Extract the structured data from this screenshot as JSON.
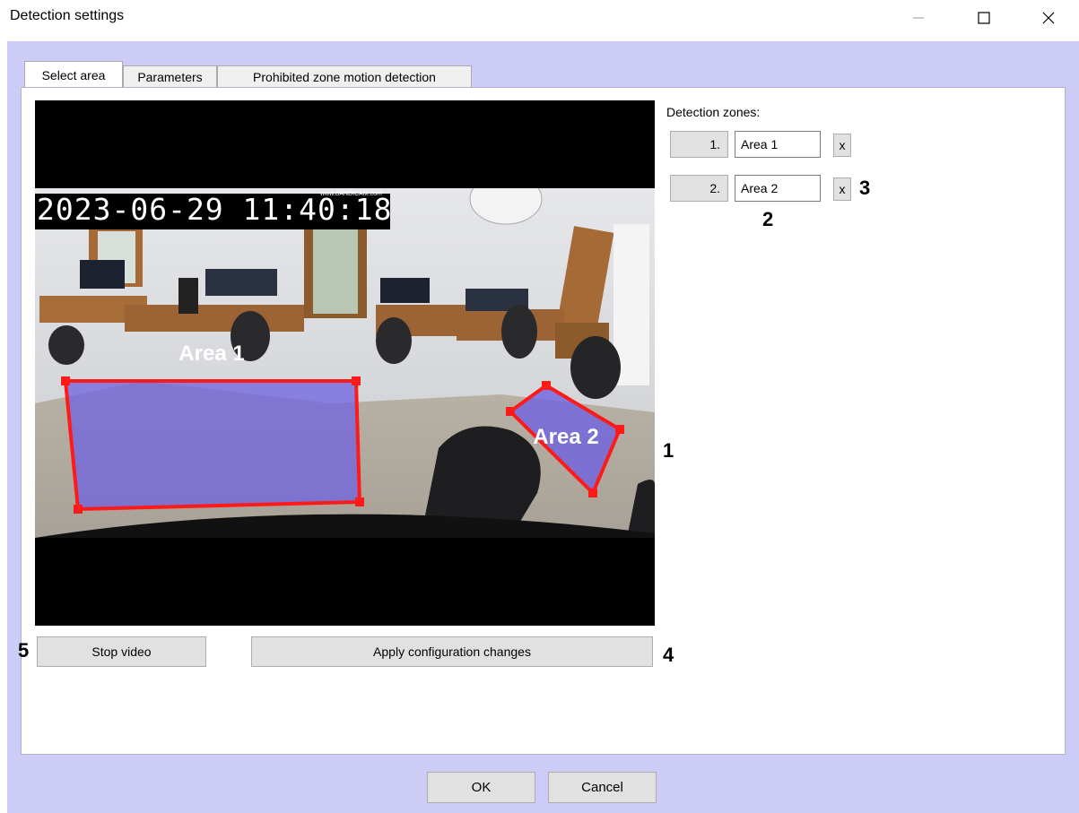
{
  "window": {
    "title": "Detection settings",
    "minimize": "—",
    "maximize": "☐",
    "close": "✕"
  },
  "tabs": [
    {
      "label": "Select area",
      "active": true
    },
    {
      "label": "Parameters",
      "active": false
    },
    {
      "label": "Prohibited zone motion detection",
      "active": false
    }
  ],
  "video": {
    "timestamp": "2023-06-29 11:40:18",
    "watermark": "www.BANDICAM.com",
    "overlay_labels": [
      "Area 1",
      "Area 2"
    ],
    "zone_color": "#ff1a1a",
    "zone_fill": "#6f62e0"
  },
  "zones": {
    "header": "Detection zones:",
    "items": [
      {
        "index": "1.",
        "name": "Area 1",
        "delete": "x"
      },
      {
        "index": "2.",
        "name": "Area 2",
        "delete": "x"
      }
    ]
  },
  "buttons": {
    "stop_video": "Stop video",
    "apply": "Apply configuration changes",
    "ok": "OK",
    "cancel": "Cancel"
  },
  "callouts": [
    "1",
    "2",
    "3",
    "4",
    "5"
  ]
}
